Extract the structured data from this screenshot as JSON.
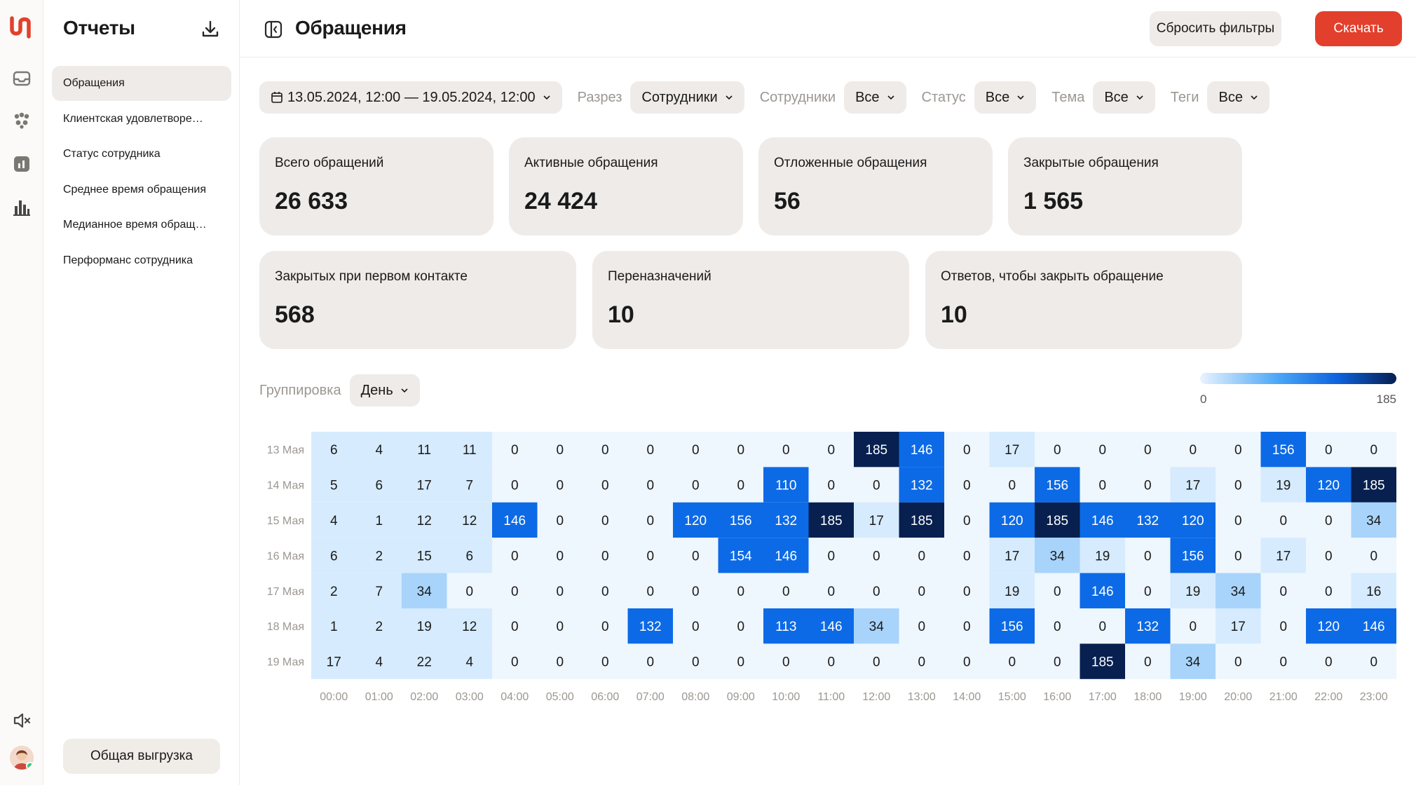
{
  "rail": {
    "icons": [
      "logo-icon",
      "inbox-icon",
      "team-icon",
      "analytics-icon",
      "bar-chart-icon",
      "mute-icon",
      "avatar"
    ]
  },
  "sidebar": {
    "title": "Отчеты",
    "items": [
      {
        "label": "Обращения",
        "active": true
      },
      {
        "label": "Клиентская удовлетворе…",
        "active": false
      },
      {
        "label": "Статус сотрудника",
        "active": false
      },
      {
        "label": "Среднее время обращения",
        "active": false
      },
      {
        "label": "Медианное время обращ…",
        "active": false
      },
      {
        "label": "Перформанс сотрудника",
        "active": false
      }
    ],
    "export_label": "Общая выгрузка"
  },
  "header": {
    "title": "Обращения",
    "reset_label": "Сбросить фильтры",
    "download_label": "Скачать",
    "accent_color": "#e2402c"
  },
  "filters": {
    "date_range": "13.05.2024, 12:00 — 19.05.2024, 12:00",
    "slice_label": "Разрез",
    "slice_value": "Сотрудники",
    "employees_label": "Сотрудники",
    "employees_value": "Все",
    "status_label": "Статус",
    "status_value": "Все",
    "topic_label": "Тема",
    "topic_value": "Все",
    "tags_label": "Теги",
    "tags_value": "Все"
  },
  "stats": [
    {
      "label": "Всего обращений",
      "value": "26 633"
    },
    {
      "label": "Активные обращения",
      "value": "24 424"
    },
    {
      "label": "Отложенные обращения",
      "value": "56"
    },
    {
      "label": "Закрытые обращения",
      "value": "1 565"
    },
    {
      "label": "Закрытых при первом контакте",
      "value": "568"
    },
    {
      "label": "Переназначений",
      "value": "10"
    },
    {
      "label": "Ответов, чтобы закрыть обращение",
      "value": "10"
    }
  ],
  "grouping": {
    "label": "Группировка",
    "value": "День"
  },
  "chart_data": {
    "type": "heatmap",
    "x": [
      "00:00",
      "01:00",
      "02:00",
      "03:00",
      "04:00",
      "05:00",
      "06:00",
      "07:00",
      "08:00",
      "09:00",
      "10:00",
      "11:00",
      "12:00",
      "13:00",
      "14:00",
      "15:00",
      "16:00",
      "17:00",
      "18:00",
      "19:00",
      "20:00",
      "21:00",
      "22:00",
      "23:00"
    ],
    "y": [
      "13 Мая",
      "14 Мая",
      "15 Мая",
      "16 Мая",
      "17 Мая",
      "18 Мая",
      "19 Мая"
    ],
    "values": [
      [
        6,
        4,
        11,
        11,
        0,
        0,
        0,
        0,
        0,
        0,
        0,
        0,
        185,
        146,
        0,
        17,
        0,
        0,
        0,
        0,
        0,
        156,
        0,
        0
      ],
      [
        5,
        6,
        17,
        7,
        0,
        0,
        0,
        0,
        0,
        0,
        110,
        0,
        0,
        132,
        0,
        0,
        156,
        0,
        0,
        17,
        0,
        19,
        120,
        185
      ],
      [
        4,
        1,
        12,
        12,
        146,
        0,
        0,
        0,
        120,
        156,
        132,
        185,
        17,
        185,
        0,
        120,
        185,
        146,
        132,
        120,
        0,
        0,
        0,
        34
      ],
      [
        6,
        2,
        15,
        6,
        0,
        0,
        0,
        0,
        0,
        154,
        146,
        0,
        0,
        0,
        0,
        17,
        34,
        19,
        0,
        156,
        0,
        17,
        0,
        0
      ],
      [
        2,
        7,
        34,
        0,
        0,
        0,
        0,
        0,
        0,
        0,
        0,
        0,
        0,
        0,
        0,
        19,
        0,
        146,
        0,
        19,
        34,
        0,
        0,
        16
      ],
      [
        1,
        2,
        19,
        12,
        0,
        0,
        0,
        132,
        0,
        0,
        113,
        146,
        34,
        0,
        0,
        156,
        0,
        0,
        132,
        0,
        17,
        0,
        120,
        146
      ],
      [
        17,
        4,
        22,
        4,
        0,
        0,
        0,
        0,
        0,
        0,
        0,
        0,
        0,
        0,
        0,
        0,
        0,
        185,
        0,
        34,
        0,
        0,
        0,
        0
      ]
    ],
    "scale_min": 0,
    "scale_max": 185,
    "legend_min_label": "0",
    "legend_max_label": "185",
    "legend_placement": "top-right",
    "colors": {
      "zero": "#eef6fe",
      "low": "#d6ebfd",
      "mid": "#a8d4fb",
      "high": "#0c6ae6",
      "max": "#07204f"
    }
  }
}
